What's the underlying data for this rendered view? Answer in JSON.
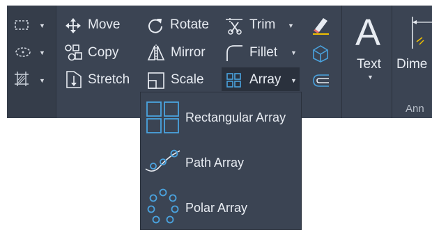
{
  "ribbon": {
    "left_tools": [
      {
        "icon": "rectangle-icon"
      },
      {
        "icon": "ellipse-icon"
      },
      {
        "icon": "hatch-icon"
      }
    ],
    "modify": {
      "move": "Move",
      "copy": "Copy",
      "stretch": "Stretch",
      "rotate": "Rotate",
      "mirror": "Mirror",
      "scale": "Scale",
      "trim": "Trim",
      "fillet": "Fillet",
      "array": "Array"
    },
    "annotation": {
      "text": "Text",
      "dimension": "Dime",
      "panel_label": "Ann"
    }
  },
  "array_menu": {
    "items": [
      {
        "label": "Rectangular Array",
        "icon": "rectangular-array-icon"
      },
      {
        "label": "Path Array",
        "icon": "path-array-icon"
      },
      {
        "label": "Polar Array",
        "icon": "polar-array-icon"
      }
    ]
  },
  "colors": {
    "ribbon_bg": "#3b4453",
    "accent_blue": "#4aa3df",
    "text": "#e8ecf2"
  }
}
